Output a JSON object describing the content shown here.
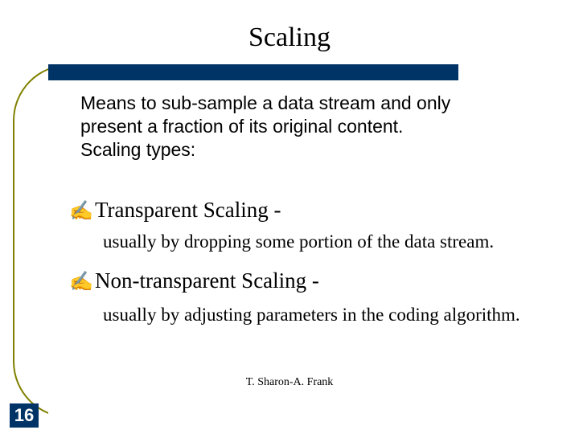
{
  "title": "Scaling",
  "intro": "Means to sub-sample a data stream and only present a fraction of its original content.\nScaling types:",
  "bullets": [
    {
      "heading": "Transparent Scaling -",
      "sub": "usually by dropping some portion of the data stream."
    },
    {
      "heading": "Non-transparent Scaling -",
      "sub": "usually by adjusting parameters in the coding algorithm."
    }
  ],
  "footer": "T. Sharon-A. Frank",
  "slide_number": "16",
  "bullet_glyph": "✍"
}
